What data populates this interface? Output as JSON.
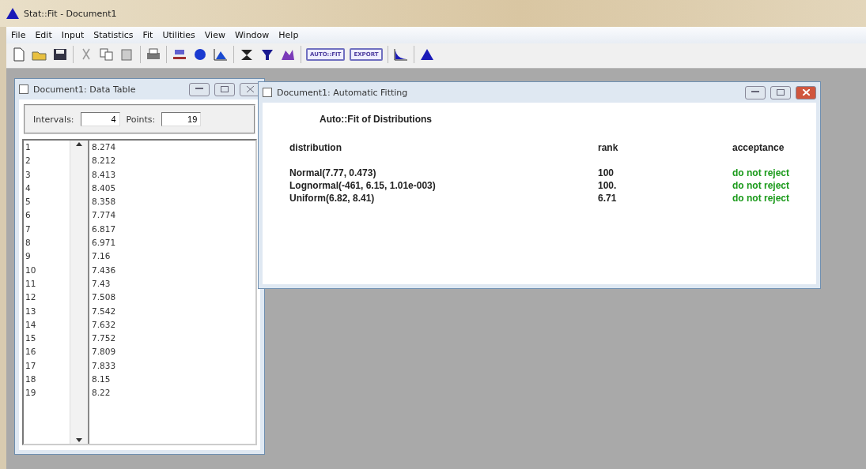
{
  "window": {
    "title": "Stat::Fit - Document1"
  },
  "menu": [
    "File",
    "Edit",
    "Input",
    "Statistics",
    "Fit",
    "Utilities",
    "View",
    "Window",
    "Help"
  ],
  "toolbar": {
    "text_buttons": [
      "AUTO::FIT",
      "EXPORT"
    ]
  },
  "data_window": {
    "title": "Document1: Data Table",
    "intervals_label": "Intervals:",
    "intervals": "4",
    "points_label": "Points:",
    "points": "19",
    "rows": [
      {
        "index": "1",
        "value": "8.274"
      },
      {
        "index": "2",
        "value": "8.212"
      },
      {
        "index": "3",
        "value": "8.413"
      },
      {
        "index": "4",
        "value": "8.405"
      },
      {
        "index": "5",
        "value": "8.358"
      },
      {
        "index": "6",
        "value": "7.774"
      },
      {
        "index": "7",
        "value": "6.817"
      },
      {
        "index": "8",
        "value": "6.971"
      },
      {
        "index": "9",
        "value": "7.16"
      },
      {
        "index": "10",
        "value": "7.436"
      },
      {
        "index": "11",
        "value": "7.43"
      },
      {
        "index": "12",
        "value": "7.508"
      },
      {
        "index": "13",
        "value": "7.542"
      },
      {
        "index": "14",
        "value": "7.632"
      },
      {
        "index": "15",
        "value": "7.752"
      },
      {
        "index": "16",
        "value": "7.809"
      },
      {
        "index": "17",
        "value": "7.833"
      },
      {
        "index": "18",
        "value": "8.15"
      },
      {
        "index": "19",
        "value": "8.22"
      }
    ]
  },
  "fit_window": {
    "title": "Document1: Automatic Fitting",
    "heading": "Auto::Fit of Distributions",
    "columns": [
      "distribution",
      "rank",
      "acceptance"
    ],
    "rows": [
      {
        "distribution": "Normal(7.77, 0.473)",
        "rank": "100",
        "acceptance": "do not reject",
        "color": "#1a9a1a"
      },
      {
        "distribution": "Lognormal(-461, 6.15, 1.01e-003)",
        "rank": "100.",
        "acceptance": "do not reject",
        "color": "#1a9a1a"
      },
      {
        "distribution": "Uniform(6.82, 8.41)",
        "rank": "6.71",
        "acceptance": "do not reject",
        "color": "#1a9a1a"
      }
    ]
  }
}
